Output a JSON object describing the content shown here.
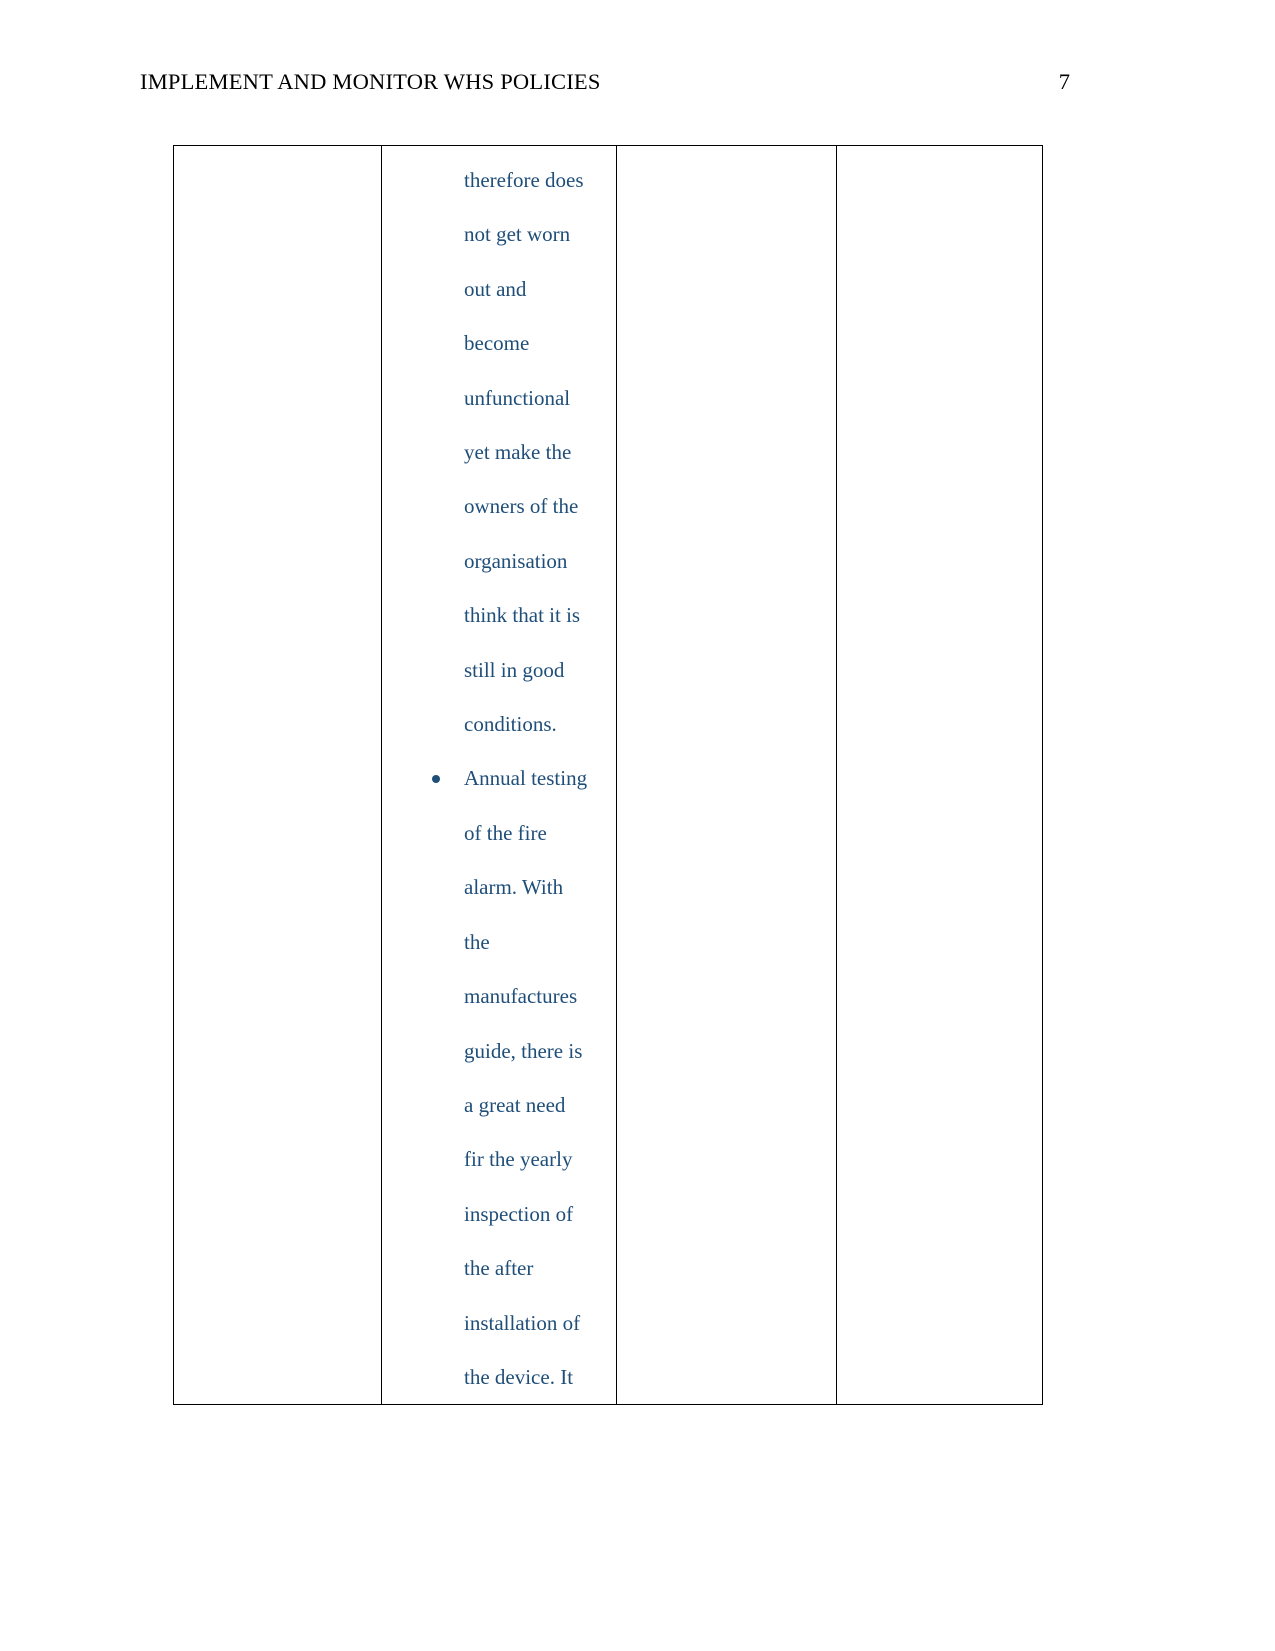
{
  "document": {
    "header": {
      "title": "IMPLEMENT AND MONITOR WHS POLICIES",
      "page_number": "7"
    },
    "text_color": "#1F4E79",
    "border_color": "#000000",
    "table": {
      "columns": 4,
      "column_1_content": "",
      "column_3_content": "",
      "column_4_content": "",
      "column_2_lines": [
        {
          "text": "therefore does",
          "bullet": false
        },
        {
          "text": "not get worn",
          "bullet": false
        },
        {
          "text": "out and",
          "bullet": false
        },
        {
          "text": "become",
          "bullet": false
        },
        {
          "text": "unfunctional",
          "bullet": false
        },
        {
          "text": "yet make the",
          "bullet": false
        },
        {
          "text": "owners of the",
          "bullet": false
        },
        {
          "text": "organisation",
          "bullet": false
        },
        {
          "text": "think that it is",
          "bullet": false
        },
        {
          "text": "still in good",
          "bullet": false
        },
        {
          "text": "conditions.",
          "bullet": false
        },
        {
          "text": "Annual testing",
          "bullet": true
        },
        {
          "text": "of the fire",
          "bullet": false
        },
        {
          "text": "alarm. With",
          "bullet": false
        },
        {
          "text": "the",
          "bullet": false
        },
        {
          "text": "manufactures",
          "bullet": false
        },
        {
          "text": "guide, there is",
          "bullet": false
        },
        {
          "text": "a great need",
          "bullet": false
        },
        {
          "text": "fir the yearly",
          "bullet": false
        },
        {
          "text": "inspection of",
          "bullet": false
        },
        {
          "text": "the after",
          "bullet": false
        },
        {
          "text": "installation of",
          "bullet": false
        },
        {
          "text": "the device. It",
          "bullet": false
        }
      ]
    }
  }
}
